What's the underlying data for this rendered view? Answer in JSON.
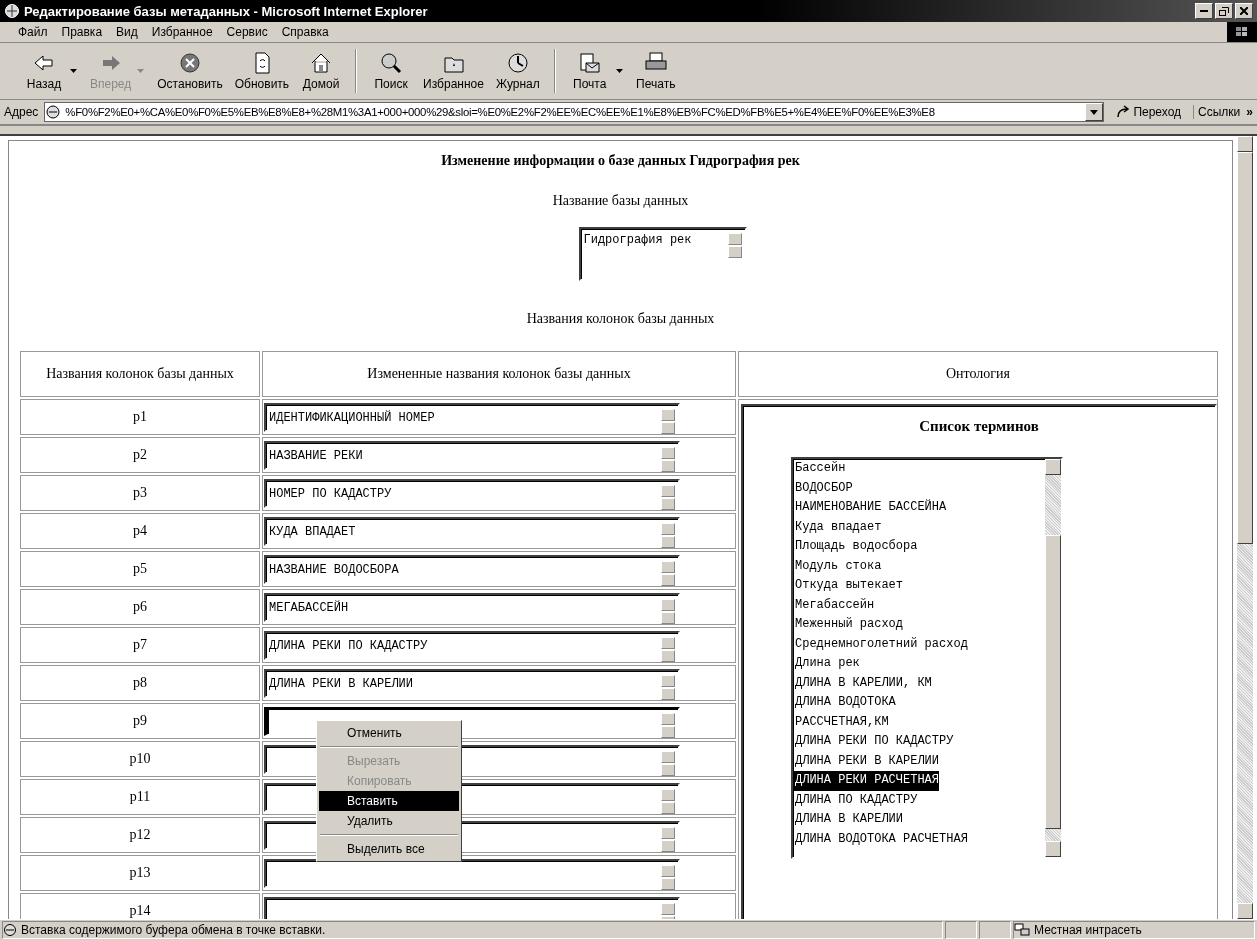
{
  "window": {
    "title": "Редактирование базы метаданных - Microsoft Internet Explorer"
  },
  "menu": [
    "Файл",
    "Правка",
    "Вид",
    "Избранное",
    "Сервис",
    "Справка"
  ],
  "toolbar": [
    {
      "label": "Назад",
      "disabled": false,
      "dropdown": true
    },
    {
      "label": "Вперед",
      "disabled": true,
      "dropdown": true
    },
    {
      "label": "Остановить",
      "disabled": false,
      "dropdown": false
    },
    {
      "label": "Обновить",
      "disabled": false,
      "dropdown": false
    },
    {
      "label": "Домой",
      "disabled": false,
      "dropdown": false
    },
    {
      "label": "Поиск",
      "disabled": false,
      "dropdown": false
    },
    {
      "label": "Избранное",
      "disabled": false,
      "dropdown": false
    },
    {
      "label": "Журнал",
      "disabled": false,
      "dropdown": false
    },
    {
      "label": "Почта",
      "disabled": false,
      "dropdown": true
    },
    {
      "label": "Печать",
      "disabled": false,
      "dropdown": false
    }
  ],
  "address": {
    "label": "Адрес",
    "value": "%F0%F2%E0+%CA%E0%F0%E5%EB%E8%E8+%28M1%3A1+000+000%29&sloi=%E0%E2%F2%EE%EC%EE%E1%E8%EB%FC%ED%FB%E5+%E4%EE%F0%EE%E3%E8",
    "go": "Переход",
    "links": "Ссылки",
    "more": "»"
  },
  "page": {
    "heading": "Изменение информации о базе данных Гидрография рек",
    "db_name_label": "Название базы данных",
    "db_name_value": "Гидрография рек",
    "columns_label": "Названия колонок базы данных",
    "table": {
      "columns": [
        "Названия колонок базы данных",
        "Измененные названия колонок базы данных",
        "Онтология"
      ],
      "rows": [
        {
          "name": "p1",
          "value": "ИДЕНТИФИКАЦИОННЫЙ НОМЕР",
          "focused": false
        },
        {
          "name": "p2",
          "value": "НАЗВАНИЕ РЕКИ",
          "focused": false
        },
        {
          "name": "p3",
          "value": "НОМЕР ПО КАДАСТРУ",
          "focused": false
        },
        {
          "name": "p4",
          "value": "КУДА ВПАДАЕТ",
          "focused": false
        },
        {
          "name": "p5",
          "value": "НАЗВАНИЕ ВОДОСБОРА",
          "focused": false
        },
        {
          "name": "p6",
          "value": "МЕГАБАССЕЙН",
          "focused": false
        },
        {
          "name": "p7",
          "value": "ДЛИНА РЕКИ ПО КАДАСТРУ",
          "focused": false
        },
        {
          "name": "p8",
          "value": "ДЛИНА РЕКИ В КАРЕЛИИ",
          "focused": false
        },
        {
          "name": "p9",
          "focused": true
        },
        {
          "name": "p10",
          "focused": false
        },
        {
          "name": "p11",
          "focused": false
        },
        {
          "name": "p12",
          "focused": false
        },
        {
          "name": "p13",
          "focused": false
        },
        {
          "name": "p14",
          "focused": false
        }
      ]
    },
    "ontology": {
      "title": "Список терминов",
      "terms": [
        {
          "text": "Бассейн",
          "selected": false
        },
        {
          "text": "ВОДОСБОР",
          "selected": false
        },
        {
          "text": "НАИМЕНОВАНИЕ БАССЕЙНА",
          "selected": false
        },
        {
          "text": "Куда впадает",
          "selected": false
        },
        {
          "text": "Площадь водосбора",
          "selected": false
        },
        {
          "text": "Модуль стока",
          "selected": false
        },
        {
          "text": "Откуда вытекает",
          "selected": false
        },
        {
          "text": "Мегабассейн",
          "selected": false
        },
        {
          "text": "Меженный расход",
          "selected": false
        },
        {
          "text": "Среднемноголетний расход",
          "selected": false
        },
        {
          "text": "Длина рек",
          "selected": false
        },
        {
          "text": "ДЛИНА В КАРЕЛИИ, КМ",
          "selected": false
        },
        {
          "text": "ДЛИНА ВОДОТОКА",
          "selected": false
        },
        {
          "text": "РАССЧЕТНАЯ,КМ",
          "selected": false
        },
        {
          "text": "ДЛИНА РЕКИ ПО КАДАСТРУ",
          "selected": false
        },
        {
          "text": "ДЛИНА РЕКИ В КАРЕЛИИ",
          "selected": false
        },
        {
          "text": "ДЛИНА РЕКИ РАСЧЕТНАЯ",
          "selected": true
        },
        {
          "text": "ДЛИНА ПО КАДАСТРУ",
          "selected": false
        },
        {
          "text": "ДЛИНА В КАРЕЛИИ",
          "selected": false
        },
        {
          "text": "ДЛИНА ВОДОТОКА РАСЧЕТНАЯ",
          "selected": false
        }
      ]
    }
  },
  "context_menu": {
    "groups": [
      [
        {
          "label": "Отменить",
          "disabled": false,
          "selected": false
        }
      ],
      [
        {
          "label": "Вырезать",
          "disabled": true,
          "selected": false
        },
        {
          "label": "Копировать",
          "disabled": true,
          "selected": false
        },
        {
          "label": "Вставить",
          "disabled": false,
          "selected": true
        },
        {
          "label": "Удалить",
          "disabled": false,
          "selected": false
        }
      ],
      [
        {
          "label": "Выделить все",
          "disabled": false,
          "selected": false
        }
      ]
    ]
  },
  "status_bar": {
    "text": "Вставка содержимого буфера обмена в точке вставки.",
    "zone": "Местная интрасеть"
  }
}
